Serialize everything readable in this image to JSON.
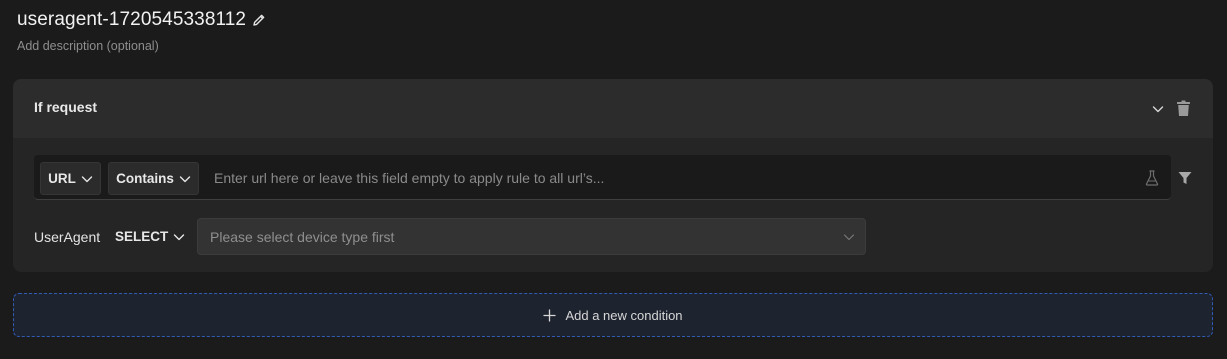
{
  "header": {
    "title": "useragent-1720545338112",
    "description_placeholder": "Add description (optional)"
  },
  "condition_card": {
    "title": "If request",
    "url_filter": {
      "source_label": "URL",
      "operator_label": "Contains",
      "input_value": "",
      "input_placeholder": "Enter url here or leave this field empty to apply rule to all url’s..."
    },
    "user_agent": {
      "label": "UserAgent",
      "select_label": "SELECT",
      "device_placeholder": "Please select device type first"
    }
  },
  "add_condition": {
    "label": "Add a new condition"
  },
  "icons": {
    "edit": "pencil-icon",
    "collapse": "chevron-down-icon",
    "delete": "trash-icon",
    "test": "flask-icon",
    "filter": "filter-icon",
    "add": "plus-icon"
  },
  "colors": {
    "background": "#1b1b1c",
    "card": "#252526",
    "card_header": "#2c2c2d",
    "add_condition_border": "#2f5bb3",
    "add_condition_bg": "#1e2330"
  }
}
